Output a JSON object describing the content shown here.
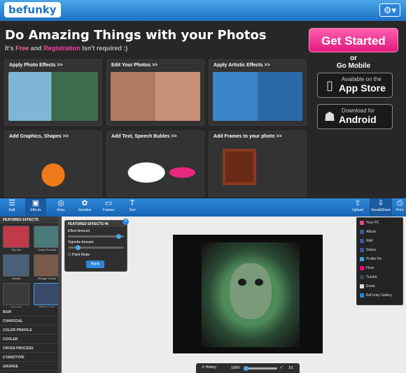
{
  "header": {
    "logo": "befunky",
    "settings_icon": "gear-icon"
  },
  "promo": {
    "headline": "Do Amazing Things with your Photos",
    "sub_pre": "It's ",
    "sub_free": "Free",
    "sub_mid": " and ",
    "sub_reg": "Registration",
    "sub_post": " Isn't required :)",
    "cta": "Get Started",
    "or": "or",
    "go_mobile": "Go Mobile",
    "appstore_small": "Available on the",
    "appstore_big": "App Store",
    "android_small": "Download for",
    "android_big": "Android",
    "cards": [
      {
        "title": "Apply Photo Effects >>"
      },
      {
        "title": "Edit Your Photos >>"
      },
      {
        "title": "Apply Artistic Effects >>"
      },
      {
        "title": "Add Graphics, Shapes >>"
      },
      {
        "title": "Add Text, Speech Bubles >>"
      },
      {
        "title": "Add Frames to your photo >>"
      }
    ]
  },
  "toolbar": {
    "tools": [
      "Edit",
      "Effects",
      "Artsy",
      "Goodies",
      "Frames",
      "Text"
    ],
    "upload": "Upload",
    "save_share": "Save&Share",
    "print": "Print"
  },
  "sidebar": {
    "title": "FEATURED EFFECTS",
    "thumbs": [
      "Pop Art",
      "Cross Process",
      "Instant",
      "Vintage Colors",
      "Holgaart",
      "Motion Color"
    ],
    "categories": [
      "B&W",
      "CHARCOAL",
      "COLOR PINHOLE",
      "COOLER",
      "CROSS PROCESS",
      "CYANOTYPE",
      "GRUNGE"
    ]
  },
  "effect_panel": {
    "title": "FEATURED EFFECTS #6",
    "effect_amount": "Effect Amount",
    "vignette_amount": "Vignette Amount",
    "paint_mode": "Paint Mode",
    "apply": "Apply",
    "effect_amount_value": 0.95,
    "vignette_amount_value": 0.15
  },
  "share_menu": [
    "Your PC",
    "Album",
    "Wall",
    "Status",
    "Profile Pic",
    "Flickr",
    "Tumblr",
    "Email",
    "BeFunky Gallery"
  ],
  "bottombar": {
    "history": "History",
    "zoom": "100%",
    "pages": "1/1"
  }
}
